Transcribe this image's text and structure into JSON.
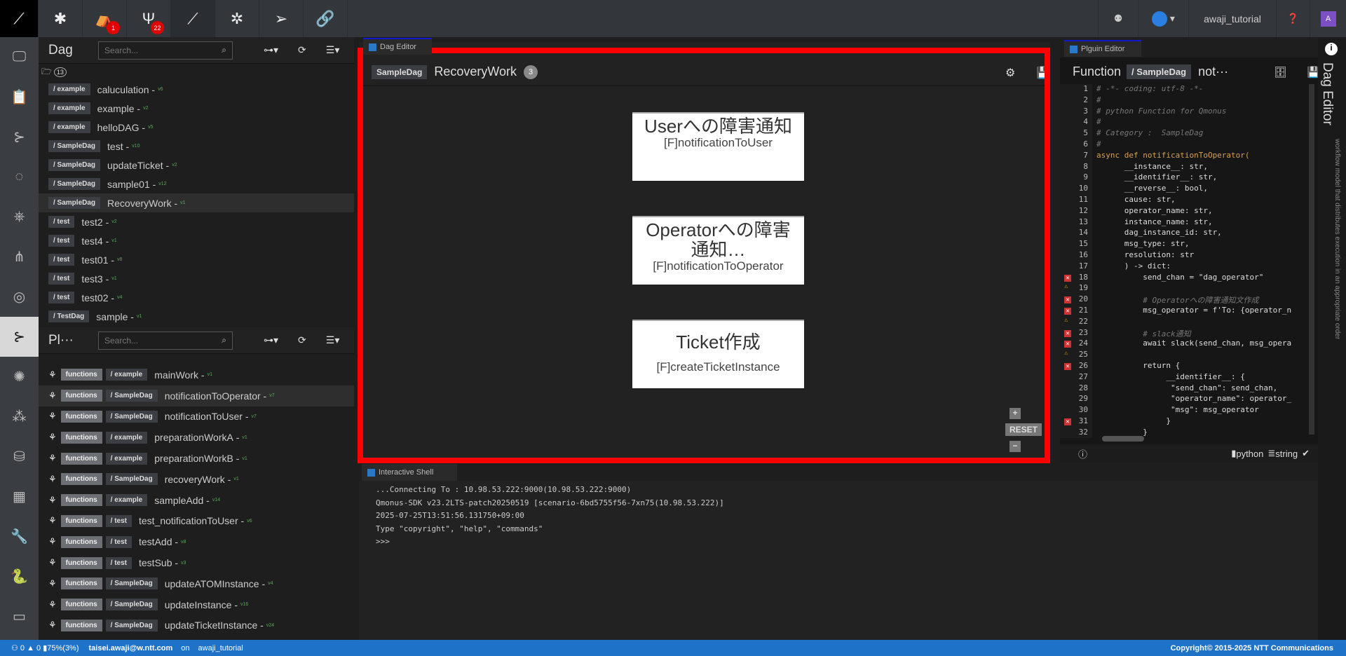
{
  "topbar": {
    "items": [
      {
        "icon": "qmonus-logo-icon"
      },
      {
        "icon": "bug-icon"
      },
      {
        "icon": "alert-icon",
        "badge": "1"
      },
      {
        "icon": "antler-icon",
        "badge": "22"
      },
      {
        "icon": "qmonus-icon"
      },
      {
        "icon": "spider-icon"
      },
      {
        "icon": "send-icon"
      },
      {
        "icon": "link-icon"
      }
    ],
    "workspace": "awaji_tutorial",
    "avatar": "A"
  },
  "dag_panel": {
    "title": "Dag",
    "search_placeholder": "Search...",
    "count": "13",
    "items": [
      {
        "ns": "/ example",
        "name": "caluculation",
        "ver": "v6"
      },
      {
        "ns": "/ example",
        "name": "example",
        "ver": "v2"
      },
      {
        "ns": "/ example",
        "name": "helloDAG",
        "ver": "v5"
      },
      {
        "ns": "/ SampleDag",
        "name": "test",
        "ver": "v10"
      },
      {
        "ns": "/ SampleDag",
        "name": "updateTicket",
        "ver": "v2"
      },
      {
        "ns": "/ SampleDag",
        "name": "sample01",
        "ver": "v12"
      },
      {
        "ns": "/ SampleDag",
        "name": "RecoveryWork",
        "ver": "v1"
      },
      {
        "ns": "/ test",
        "name": "test2",
        "ver": "v2"
      },
      {
        "ns": "/ test",
        "name": "test4",
        "ver": "v1"
      },
      {
        "ns": "/ test",
        "name": "test01",
        "ver": "v8"
      },
      {
        "ns": "/ test",
        "name": "test3",
        "ver": "v1"
      },
      {
        "ns": "/ test",
        "name": "test02",
        "ver": "v4"
      },
      {
        "ns": "/ TestDag",
        "name": "sample",
        "ver": "v1"
      }
    ]
  },
  "plugin_panel": {
    "title": "Pl···",
    "search_placeholder": "Search...",
    "items": [
      {
        "type": "functions",
        "ns": "/ example",
        "name": "mainWork",
        "ver": "v1"
      },
      {
        "type": "functions",
        "ns": "/ SampleDag",
        "name": "notificationToOperator",
        "ver": "v7"
      },
      {
        "type": "functions",
        "ns": "/ SampleDag",
        "name": "notificationToUser",
        "ver": "v7"
      },
      {
        "type": "functions",
        "ns": "/ example",
        "name": "preparationWorkA",
        "ver": "v1"
      },
      {
        "type": "functions",
        "ns": "/ example",
        "name": "preparationWorkB",
        "ver": "v1"
      },
      {
        "type": "functions",
        "ns": "/ SampleDag",
        "name": "recoveryWork",
        "ver": "v1"
      },
      {
        "type": "functions",
        "ns": "/ example",
        "name": "sampleAdd",
        "ver": "v14"
      },
      {
        "type": "functions",
        "ns": "/ test",
        "name": "test_notificationToUser",
        "ver": "v6"
      },
      {
        "type": "functions",
        "ns": "/ test",
        "name": "testAdd",
        "ver": "v8"
      },
      {
        "type": "functions",
        "ns": "/ test",
        "name": "testSub",
        "ver": "v3"
      },
      {
        "type": "functions",
        "ns": "/ SampleDag",
        "name": "updateATOMInstance",
        "ver": "v4"
      },
      {
        "type": "functions",
        "ns": "/ SampleDag",
        "name": "updateInstance",
        "ver": "v16"
      },
      {
        "type": "functions",
        "ns": "/ SampleDag",
        "name": "updateTicketInstance",
        "ver": "v24"
      }
    ]
  },
  "dag_editor": {
    "tab": "Dag Editor",
    "ns": "SampleDag",
    "name": "RecoveryWork",
    "count": "3",
    "nodes": [
      {
        "title": "Userへの障害通知",
        "func": "[F]notificationToUser"
      },
      {
        "title": "Operatorへの障害通知…",
        "func": "[F]notificationToOperator"
      },
      {
        "title": "Ticket作成",
        "func": "[F]createTicketInstance"
      }
    ],
    "zoom_in": "+",
    "reset": "RESET",
    "zoom_out": "−"
  },
  "plugin_editor": {
    "tab": "Plguin Editor",
    "kind": "Function",
    "ns": "/ SampleDag",
    "name": "not···",
    "lang": "python",
    "type": "string",
    "lines": [
      {
        "n": "1",
        "t": "# -*- coding: utf-8 -*-"
      },
      {
        "n": "2",
        "t": "#"
      },
      {
        "n": "3",
        "t": "# python Function for Qmonus"
      },
      {
        "n": "4",
        "t": "#"
      },
      {
        "n": "5",
        "t": "# Category :  SampleDag"
      },
      {
        "n": "6",
        "t": "#"
      },
      {
        "n": "7",
        "t": "async def notificationToOperator("
      },
      {
        "n": "8",
        "t": "      __instance__: str,"
      },
      {
        "n": "9",
        "t": "      __identifier__: str,"
      },
      {
        "n": "10",
        "t": "      __reverse__: bool,"
      },
      {
        "n": "11",
        "t": "      cause: str,"
      },
      {
        "n": "12",
        "t": "      operator_name: str,"
      },
      {
        "n": "13",
        "t": "      instance_name: str,"
      },
      {
        "n": "14",
        "t": "      dag_instance_id: str,"
      },
      {
        "n": "15",
        "t": "      msg_type: str,"
      },
      {
        "n": "16",
        "t": "      resolution: str"
      },
      {
        "n": "17",
        "t": "      ) -> dict:"
      },
      {
        "n": "18",
        "t": "          send_chan = \"dag_operator\"",
        "m": "e"
      },
      {
        "n": "19",
        "t": "",
        "m": "w"
      },
      {
        "n": "20",
        "t": "          # Operatorへの障害通知文作成",
        "m": "e"
      },
      {
        "n": "21",
        "t": "          msg_operator = f'To: {operator_n",
        "m": "e"
      },
      {
        "n": "22",
        "t": "",
        "m": "w"
      },
      {
        "n": "23",
        "t": "          # slack通知",
        "m": "e"
      },
      {
        "n": "24",
        "t": "          await slack(send_chan, msg_opera",
        "m": "e"
      },
      {
        "n": "25",
        "t": "",
        "m": "w"
      },
      {
        "n": "26",
        "t": "          return {",
        "m": "e"
      },
      {
        "n": "27",
        "t": "               __identifier__: {"
      },
      {
        "n": "28",
        "t": "                \"send_chan\": send_chan,"
      },
      {
        "n": "29",
        "t": "                \"operator_name\": operator_"
      },
      {
        "n": "30",
        "t": "                \"msg\": msg_operator"
      },
      {
        "n": "31",
        "t": "               }",
        "m": "e"
      },
      {
        "n": "32",
        "t": "          }"
      }
    ]
  },
  "side": {
    "title": "Dag Editor",
    "desc": "workflow model that distributes execution in an appropriate order"
  },
  "shell": {
    "tab": "Interactive Shell",
    "lines": [
      "...Connecting To : 10.98.53.222:9000(10.98.53.222:9000)",
      "Qmonus-SDK v23.2LTS-patch20250519 [scenario-6bd5755f56-7xn75(10.98.53.222)]",
      "2025-07-25T13:51:56.131750+09:00",
      "Type \"copyright\", \"help\", \"commands\"",
      ">>>"
    ]
  },
  "status": {
    "left": "⚇ 0 ▲ 0 ▮75%(3%)",
    "user": "taisei.awaji@w.ntt.com",
    "on": "on",
    "workspace": "awaji_tutorial",
    "copyright": "Copyright© 2015-2025 NTT Communications"
  }
}
